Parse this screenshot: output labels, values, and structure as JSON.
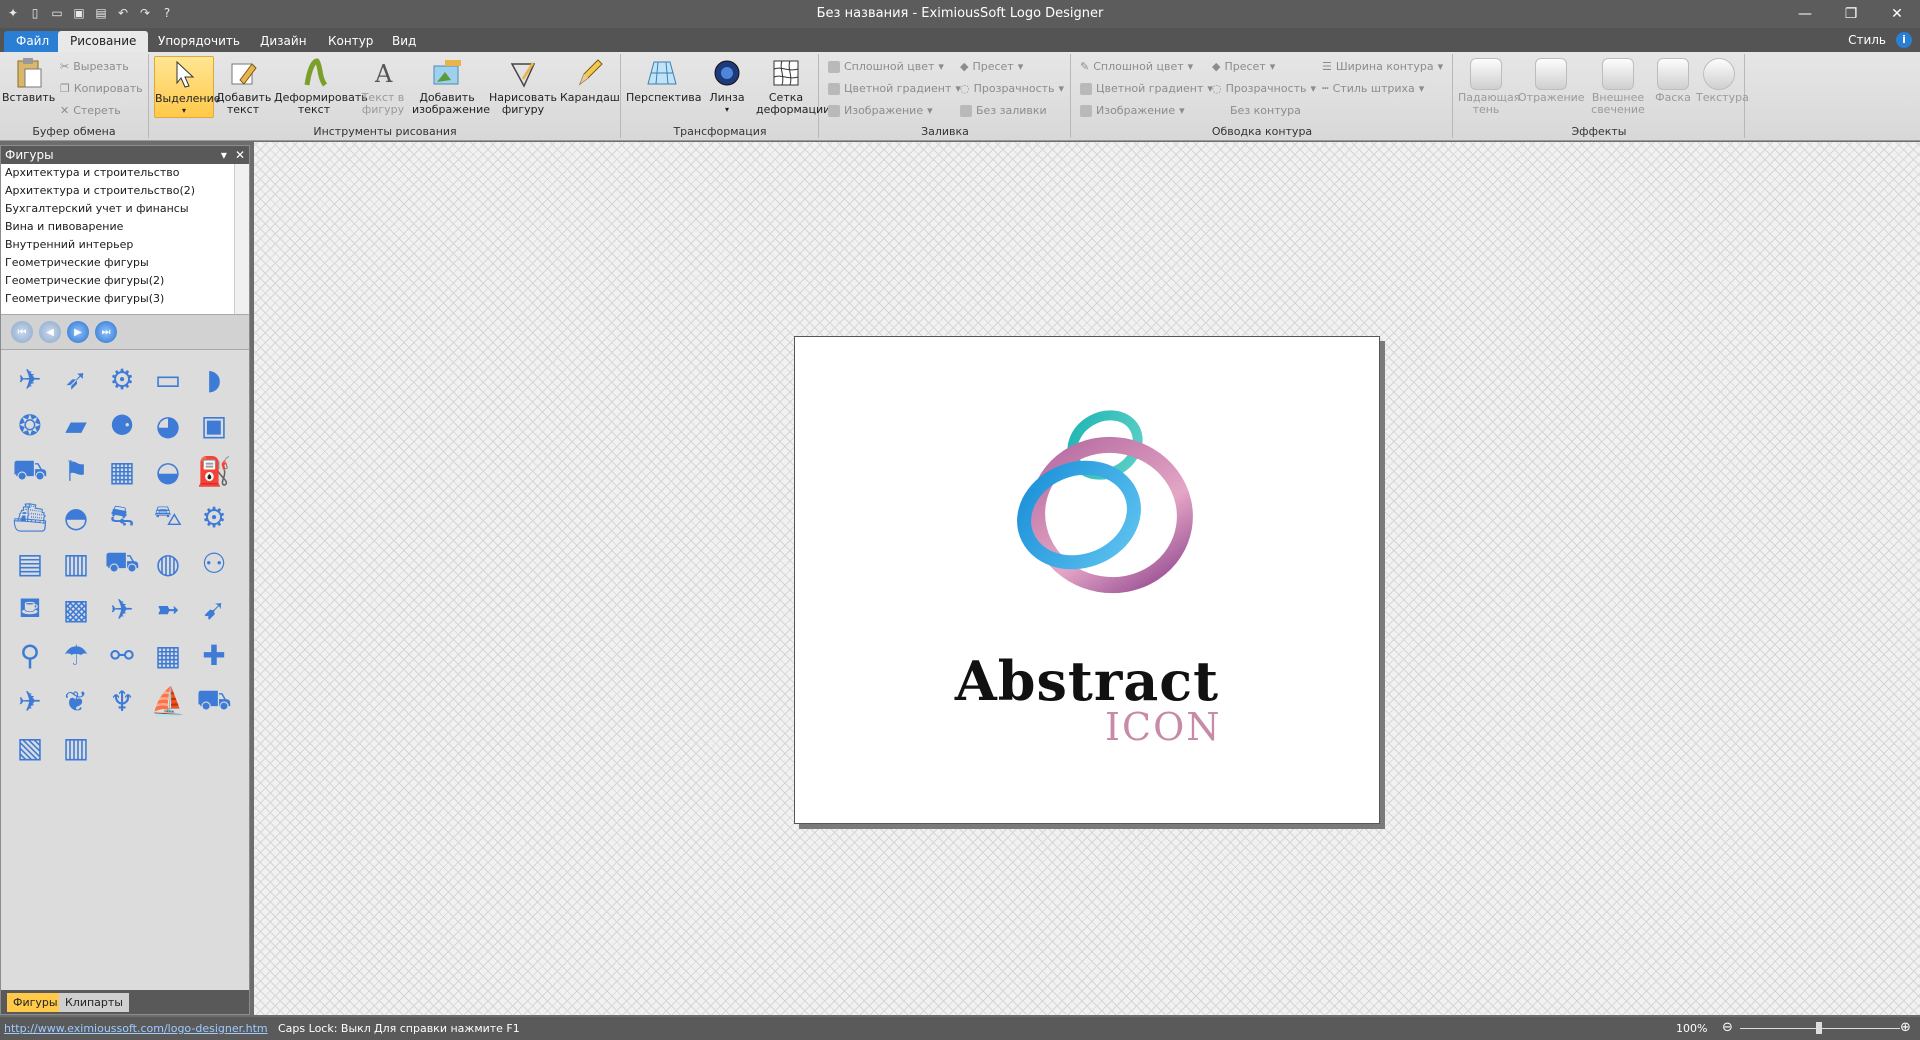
{
  "window": {
    "title": "Без названия - EximiousSoft Logo Designer"
  },
  "tabs": {
    "file": "Файл",
    "draw": "Рисование",
    "arrange": "Упорядочить",
    "design": "Дизайн",
    "outline": "Контур",
    "view": "Вид"
  },
  "style_label": "Стиль",
  "clipboard": {
    "group": "Буфер обмена",
    "paste": "Вставить",
    "cut": "Вырезать",
    "copy": "Копировать",
    "erase": "Стереть"
  },
  "draw_tools": {
    "group": "Инструменты рисования",
    "select": "Выделение",
    "add_text_1": "Добавить",
    "add_text_2": "текст",
    "deform_text_1": "Деформировать",
    "deform_text_2": "текст",
    "text_in_shape_1": "Текст в",
    "text_in_shape_2": "фигуру",
    "add_image_1": "Добавить",
    "add_image_2": "изображение",
    "draw_shape_1": "Нарисовать",
    "draw_shape_2": "фигуру",
    "pencil": "Карандаш"
  },
  "transform": {
    "group": "Трансформация",
    "perspective": "Перспектива",
    "lens": "Линза",
    "grid_1": "Сетка",
    "grid_2": "деформации"
  },
  "fill": {
    "group": "Заливка",
    "solid": "Сплошной цвет",
    "gradient": "Цветной градиент",
    "image": "Изображение",
    "preset": "Пресет",
    "transparency": "Прозрачность",
    "none": "Без заливки"
  },
  "outline": {
    "group": "Обводка контура",
    "solid": "Сплошной цвет",
    "gradient": "Цветной градиент",
    "image": "Изображение",
    "preset": "Пресет",
    "transparency": "Прозрачность",
    "none": "Без контура",
    "width": "Ширина контура",
    "dash": "Стиль штриха"
  },
  "effects": {
    "group": "Эффекты",
    "shadow_1": "Падающая",
    "shadow_2": "тень",
    "reflection": "Отражение",
    "glow_1": "Внешнее",
    "glow_2": "свечение",
    "bevel": "Фаска",
    "texture": "Текстура"
  },
  "panel": {
    "title": "Фигуры",
    "categories": [
      "Архитектура и строительство",
      "Архитектура и строительство(2)",
      "Бухгалтерский учет и финансы",
      "Вина и пивоварение",
      "Внутренний интерьер",
      "Геометрические фигуры",
      "Геометрические фигуры(2)",
      "Геометрические фигуры(3)"
    ],
    "tab_shapes": "Фигуры",
    "tab_cliparts": "Клипарты"
  },
  "logo": {
    "main": "Abstract",
    "sub": "ICON",
    "sub_color": "#c78aa7"
  },
  "status": {
    "url": "http://www.eximioussoft.com/logo-designer.htm",
    "caps": "Caps Lock: Выкл",
    "help": "Для справки нажмите F1",
    "zoom": "100%"
  },
  "colors": {
    "accent": "#2a7fd4",
    "selected": "#ffc94a",
    "icon": "#3d7bd6"
  }
}
